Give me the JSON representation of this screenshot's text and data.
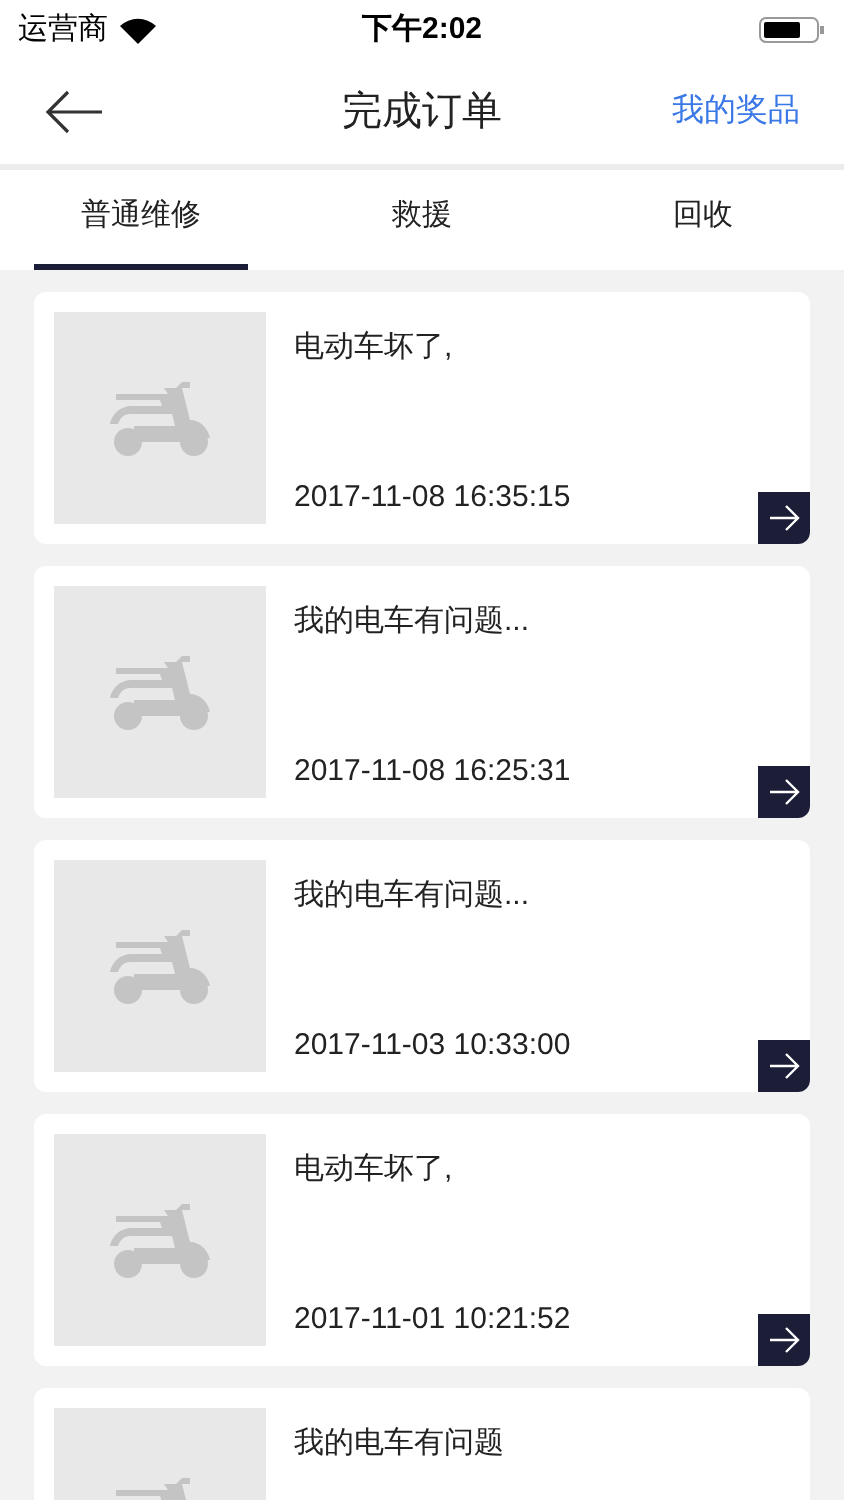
{
  "status_bar": {
    "carrier": "运营商",
    "time": "下午2:02"
  },
  "nav": {
    "title": "完成订单",
    "action": "我的奖品"
  },
  "tabs": [
    {
      "label": "普通维修",
      "selected": true
    },
    {
      "label": "救援",
      "selected": false
    },
    {
      "label": "回收",
      "selected": false
    }
  ],
  "orders": [
    {
      "title": "电动车坏了,",
      "time": "2017-11-08 16:35:15"
    },
    {
      "title": "我的电车有问题...",
      "time": "2017-11-08 16:25:31"
    },
    {
      "title": "我的电车有问题...",
      "time": "2017-11-03 10:33:00"
    },
    {
      "title": "电动车坏了,",
      "time": "2017-11-01 10:21:52"
    },
    {
      "title": "我的电车有问题"
    }
  ]
}
